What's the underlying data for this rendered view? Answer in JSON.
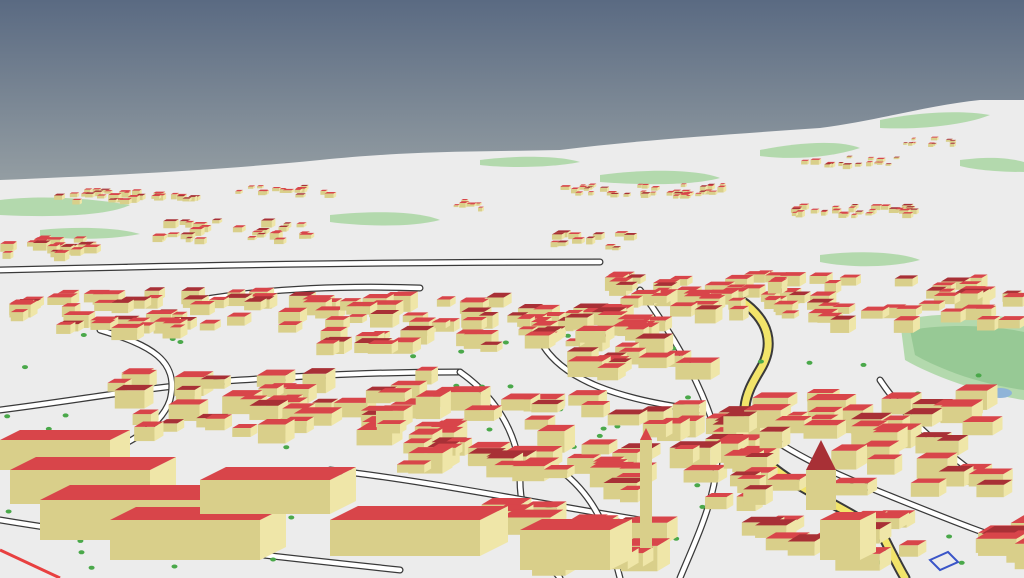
{
  "view": {
    "type": "3d-city-map",
    "colors": {
      "sky_top": "#5a6a82",
      "sky_horizon": "#9aa3a6",
      "terrain": "#ececec",
      "terrain_shade": "#d9d9d9",
      "forest": "#a9d6a2",
      "forest_dark": "#8cc28a",
      "road": "#ffffff",
      "road_edge": "#3a3a3a",
      "main_road": "#f2e46a",
      "wall": "#d9cf8a",
      "wall_light": "#efe6a8",
      "roof": "#d8454a",
      "roof_dark": "#a83036",
      "tree": "#4aa84a",
      "water": "#8fb4d8"
    }
  }
}
